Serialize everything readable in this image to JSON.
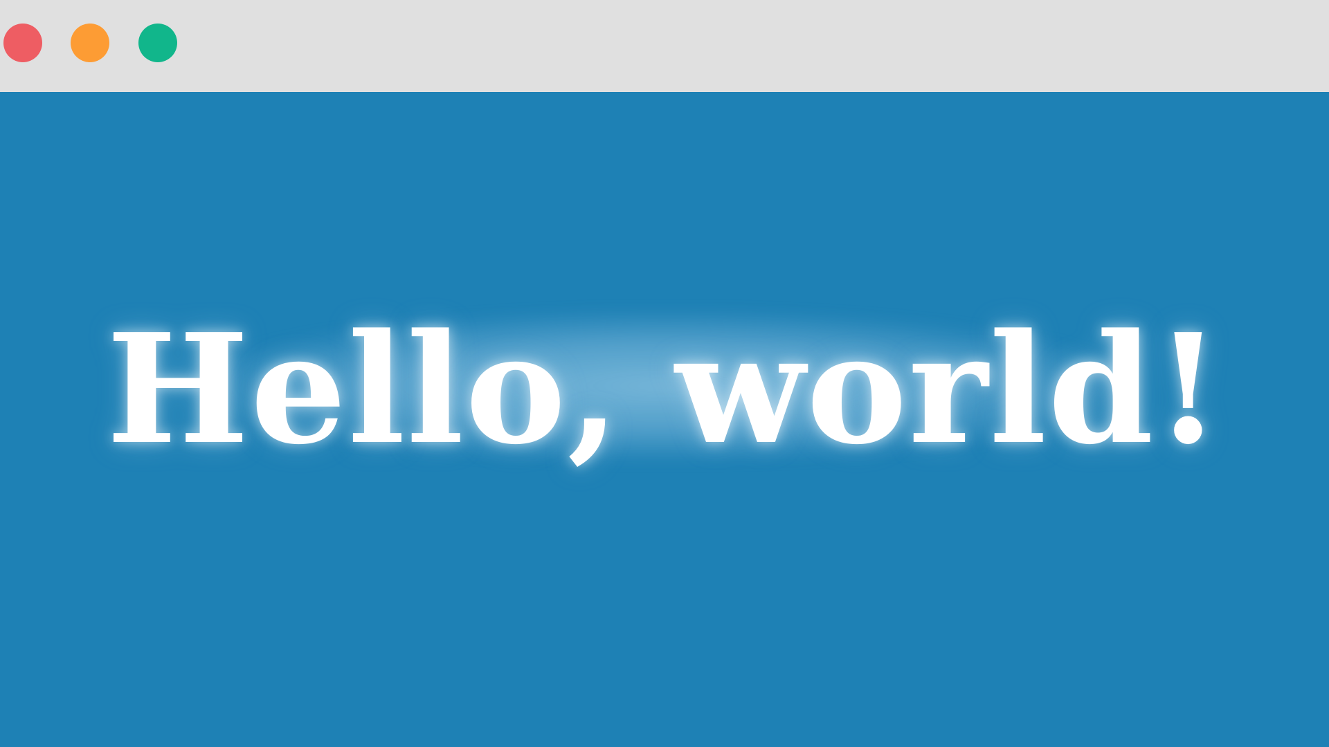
{
  "window": {
    "controls": [
      {
        "name": "close",
        "color": "#ee5d63"
      },
      {
        "name": "minimize",
        "color": "#fd9c34"
      },
      {
        "name": "maximize",
        "color": "#11b68b"
      }
    ],
    "titlebar_color": "#e0e0e0",
    "background_color": "#1e81b5"
  },
  "main": {
    "headline": "Hello, world!",
    "text_color": "#ffffff"
  }
}
